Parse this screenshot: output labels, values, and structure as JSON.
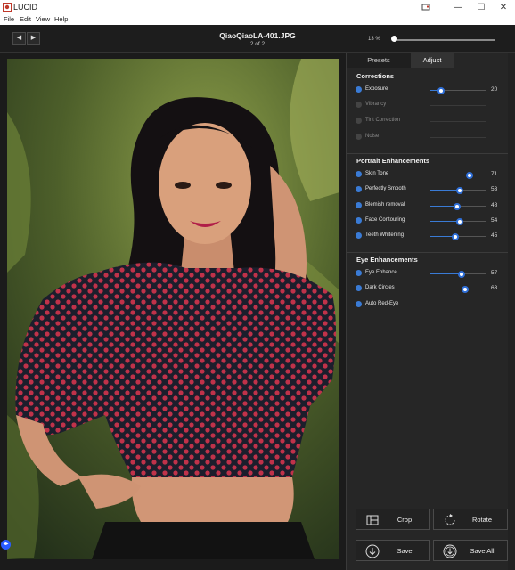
{
  "window": {
    "title": "LUCID",
    "minimize": "—",
    "maximize": "☐",
    "close": "✕"
  },
  "menu": [
    "File",
    "Edit",
    "View",
    "Help"
  ],
  "topbar": {
    "prev": "◀",
    "next": "▶",
    "filename": "QiaoQiaoLA-401.JPG",
    "counter": "2 of 2",
    "zoom_label": "13 %",
    "zoom": 0.01
  },
  "tabs": [
    {
      "label": "Presets",
      "active": false
    },
    {
      "label": "Adjust",
      "active": true
    }
  ],
  "sections": [
    {
      "title": "Corrections",
      "rows": [
        {
          "label": "Exposure",
          "enabled": true,
          "value": "20",
          "level": 0.2
        },
        {
          "label": "Vibrancy",
          "enabled": false,
          "value": "",
          "level": null
        },
        {
          "label": "Tint Correction",
          "enabled": false,
          "value": "",
          "level": null
        },
        {
          "label": "Noise",
          "enabled": false,
          "value": "",
          "level": null
        }
      ]
    },
    {
      "title": "Portrait Enhancements",
      "rows": [
        {
          "label": "Skin Tone",
          "enabled": true,
          "value": "71",
          "level": 0.71
        },
        {
          "label": "Perfectly Smooth",
          "enabled": true,
          "value": "53",
          "level": 0.53
        },
        {
          "label": "Blemish removal",
          "enabled": true,
          "value": "48",
          "level": 0.48
        },
        {
          "label": "Face Contouring",
          "enabled": true,
          "value": "54",
          "level": 0.54
        },
        {
          "label": "Teeth Whitening",
          "enabled": true,
          "value": "45",
          "level": 0.45
        }
      ]
    },
    {
      "title": "Eye Enhancements",
      "rows": [
        {
          "label": "Eye Enhance",
          "enabled": true,
          "value": "57",
          "level": 0.57
        },
        {
          "label": "Dark Circles",
          "enabled": true,
          "value": "63",
          "level": 0.63
        },
        {
          "label": "Auto Red-Eye",
          "enabled": true,
          "value": "",
          "level": null
        }
      ]
    }
  ],
  "actions": {
    "crop": {
      "label": "Crop",
      "icon": "crop-icon"
    },
    "rotate": {
      "label": "Rotate",
      "icon": "rotate-icon"
    },
    "save": {
      "label": "Save",
      "icon": "save-icon"
    },
    "save_all": {
      "label": "Save All",
      "icon": "save-all-icon"
    }
  },
  "colors": {
    "accent": "#3a7bd5",
    "panel": "#262626",
    "background": "#1b1b1b"
  }
}
